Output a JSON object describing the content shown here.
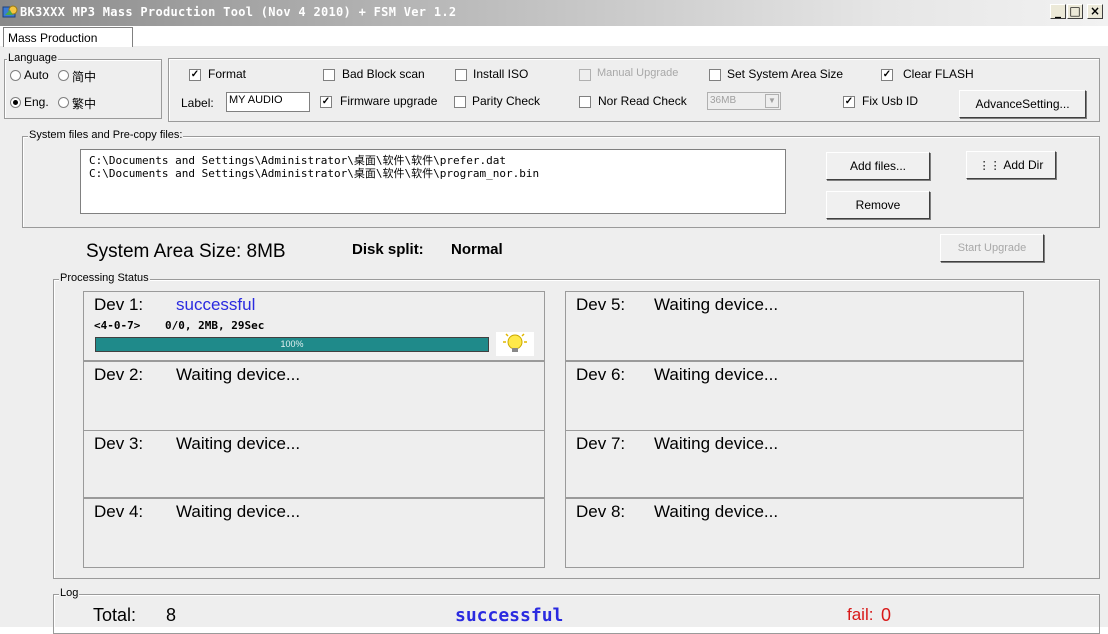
{
  "window": {
    "title": "BK3XXX MP3 Mass Production Tool (Nov 4 2010) + FSM Ver 1.2",
    "minimize": "_",
    "maximize": "□",
    "close": "×"
  },
  "tabs": [
    "Mass Production"
  ],
  "language": {
    "group_label": "Language",
    "options": [
      {
        "label": "Auto",
        "selected": false
      },
      {
        "label": "简中",
        "selected": false
      },
      {
        "label": "Eng.",
        "selected": true
      },
      {
        "label": "繁中",
        "selected": false
      }
    ]
  },
  "options": {
    "format": {
      "label": "Format",
      "checked": true
    },
    "bad_block_scan": {
      "label": "Bad Block scan",
      "checked": false
    },
    "install_iso": {
      "label": "Install ISO",
      "checked": false
    },
    "manual_upgrade": {
      "label": "Manual Upgrade",
      "checked": false,
      "disabled": true
    },
    "set_system_area_size": {
      "label": "Set System Area Size",
      "checked": false
    },
    "clear_flash": {
      "label": "Clear FLASH",
      "checked": true
    },
    "label_caption": "Label:",
    "label_value": "MY AUDIO",
    "firmware_upgrade": {
      "label": "Firmware upgrade",
      "checked": true
    },
    "parity_check": {
      "label": "Parity Check",
      "checked": false
    },
    "nor_read_check": {
      "label": "Nor Read Check",
      "checked": false
    },
    "nor_size": "36MB",
    "fix_usb_id": {
      "label": "Fix Usb ID",
      "checked": true
    },
    "advance_setting": "AdvanceSetting..."
  },
  "system_files": {
    "group_label": "System files and Pre-copy files:",
    "files": [
      "C:\\Documents and Settings\\Administrator\\桌面\\软件\\软件\\prefer.dat",
      "C:\\Documents and Settings\\Administrator\\桌面\\软件\\软件\\program_nor.bin"
    ],
    "add_files": "Add files...",
    "add_dir": "Add Dir",
    "remove": "Remove"
  },
  "summary": {
    "system_area": "System Area Size: 8MB",
    "disk_split_label": "Disk split:",
    "disk_split_value": "Normal",
    "start_upgrade": "Start Upgrade"
  },
  "processing": {
    "group_label": "Processing Status",
    "devices": [
      {
        "name": "Dev 1:",
        "status": "successful",
        "port": "<4-0-7>",
        "info": "0/0, 2MB, 29Sec",
        "progress_label": "100%",
        "progress": 1.0
      },
      {
        "name": "Dev 2:",
        "status": "Waiting device..."
      },
      {
        "name": "Dev 3:",
        "status": "Waiting device..."
      },
      {
        "name": "Dev 4:",
        "status": "Waiting device..."
      },
      {
        "name": "Dev 5:",
        "status": "Waiting device..."
      },
      {
        "name": "Dev 6:",
        "status": "Waiting device..."
      },
      {
        "name": "Dev 7:",
        "status": "Waiting device..."
      },
      {
        "name": "Dev 8:",
        "status": "Waiting device..."
      }
    ]
  },
  "log": {
    "group_label": "Log",
    "total_label": "Total:",
    "total_value": "8",
    "successful_label": "successful",
    "fail_label": "fail:",
    "fail_value": "0"
  },
  "colors": {
    "success": "#2a2ae0",
    "fail": "#d81818",
    "progress_fill": "#1f8a8a"
  },
  "icons": {
    "app": "app-icon",
    "dev1_status": "lightbulb-icon",
    "add_dir": "folder-icon"
  }
}
